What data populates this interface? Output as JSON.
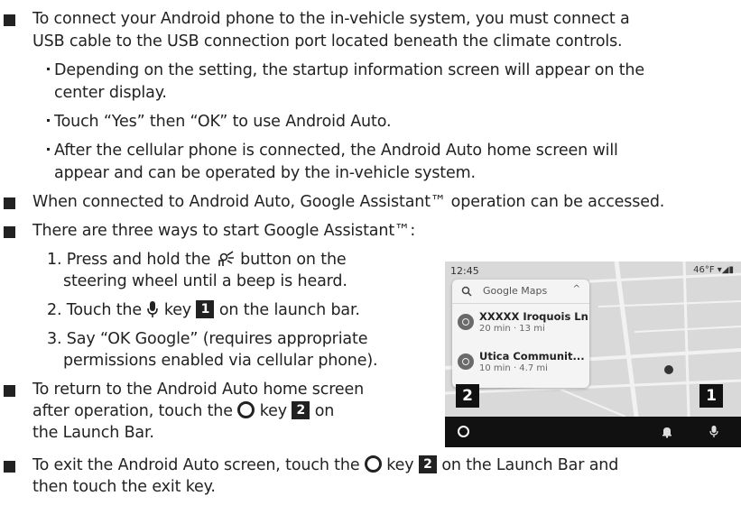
{
  "paragraphs": {
    "p1_l1": "To connect your Android phone to the in-vehicle system, you must connect a",
    "p1_l2": "USB cable to the USB connection port located beneath the climate controls.",
    "s1_l1": "Depending on the setting, the startup information screen will appear on the",
    "s1_l2": "center display.",
    "s2_l1": "Touch “Yes” then “OK” to use Android Auto.",
    "s3_l1": "After the cellular phone is connected, the Android Auto home screen will",
    "s3_l2": "appear and can be operated by the in-vehicle system.",
    "p2": "When connected to Android Auto, Google Assistant™ operation can be accessed.",
    "p3": "There are three ways to start Google Assistant™:",
    "n1_a": "1. Press and hold the",
    "n1_b": "button on the",
    "n1_l2": "steering wheel until a beep is heard.",
    "n2_a": "2. Touch the",
    "n2_b": "key",
    "n2_c": "on the launch bar.",
    "n3_l1": "3. Say “OK Google” (requires appropriate",
    "n3_l2": "permissions enabled via cellular phone).",
    "p4_l1": "To return to the Android Auto home screen",
    "p4_l2a": "after operation, touch the",
    "p4_l2b": "key",
    "p4_l2c": "on",
    "p4_l3": "the Launch Bar.",
    "p5_l1a": "To exit the Android Auto screen, touch the",
    "p5_l1b": "key",
    "p5_l1c": "on the Launch Bar and",
    "p5_l2": "then touch the exit key."
  },
  "tags": {
    "one": "1",
    "two": "2"
  },
  "screen": {
    "time": "12:45",
    "status_right": "46°F",
    "search_text": "Google Maps",
    "destinations": [
      {
        "name": "XXXXX Iroquois Ln",
        "detail": "20 min · 13 mi"
      },
      {
        "name": "Utica Communit...",
        "detail": "10 min · 4.7 mi"
      }
    ],
    "callout_left": "2",
    "callout_right": "1"
  },
  "icons": [
    "voice-recognition-icon",
    "microphone-icon",
    "home-circle-icon",
    "bell-icon",
    "search-icon",
    "location-pin-icon"
  ]
}
